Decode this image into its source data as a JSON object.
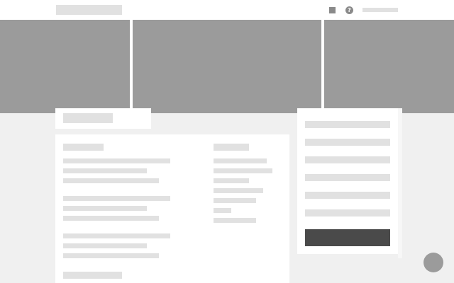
{
  "header": {
    "icons": [
      "square-icon",
      "help-icon"
    ],
    "help_glyph": "?"
  },
  "colors": {
    "page_background": "#f0f0f0",
    "card_background": "#ffffff",
    "placeholder": "#e1e1e1",
    "image_placeholder": "#9b9b9b",
    "primary_button": "#4a4a4a",
    "icon": "#8a8a8a"
  }
}
